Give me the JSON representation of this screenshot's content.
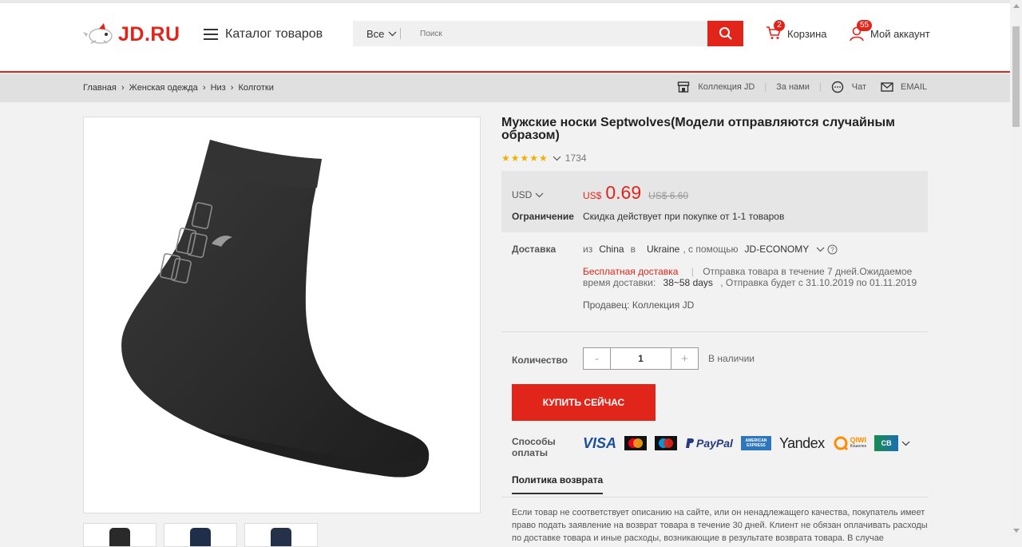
{
  "header": {
    "logo_text": "JD.RU",
    "catalog_label": "Каталог товаров",
    "search": {
      "scope": "Все",
      "placeholder": "Поиск"
    },
    "cart": {
      "label": "Корзина",
      "count": "2"
    },
    "account": {
      "label": "Мой аккаунт",
      "count": "55"
    }
  },
  "breadcrumbs": [
    "Главная",
    "Женская одежда",
    "Низ",
    "Колготки"
  ],
  "breadcrumb_sep": "›",
  "sublinks": {
    "collection": "Коллекция JD",
    "about": "За нами",
    "chat": "Чат",
    "email": "EMAIL"
  },
  "product": {
    "title": "Мужские носки Septwolves(Модели отправляются случайным образом)",
    "rating_stars": "★★★★★",
    "reviews": "1734",
    "currency_selector": "USD",
    "price_currency": "US$",
    "price": "0.69",
    "old_price": "US$ 6.60",
    "limit_label": "Ограничение",
    "limit_text": "Скидка действует при покупке от 1-1 товаров"
  },
  "shipping": {
    "label": "Доставка",
    "from_word": "из",
    "from": "China",
    "to_word": "в",
    "to": "Ukraine",
    "via": ", с помощью",
    "method": "JD-ECONOMY",
    "free": "Бесплатная доставка",
    "dispatch_text": "Отправка товара в течение 7 дней.Ожидаемое время доставки:",
    "days": "38~58 days",
    "arrival_text": ", Отправка будет с 31.10.2019 по 01.11.2019",
    "seller": "Продавец: Коллекция JD"
  },
  "quantity": {
    "label": "Количество",
    "minus": "-",
    "value": "1",
    "plus": "+",
    "stock": "В наличии"
  },
  "buy_label": "КУПИТЬ СЕЙЧАС",
  "payments": {
    "label": "Способы оплаты",
    "visa": "VISA",
    "paypal": "PayPal",
    "amex": "AMERICAN EXPRESS",
    "yandex": "Yandex",
    "qiwi": "QIWI",
    "qiwi_sub": "Кошелек",
    "cb": "CB"
  },
  "returns": {
    "tab": "Политика возврата",
    "text": "Если товар не соответствует описанию на сайте, или он ненадлежащего качества, покупатель имеет право подать заявление на возврат товара в течение 30 дней. Клиент не обязан оплачивать расходы по доставке товара и иные расходы, возникающие в результате возврата товара. В случае"
  },
  "colors": {
    "accent": "#e1251b",
    "star": "#f0b000",
    "price_box": "#e6e6e6"
  }
}
